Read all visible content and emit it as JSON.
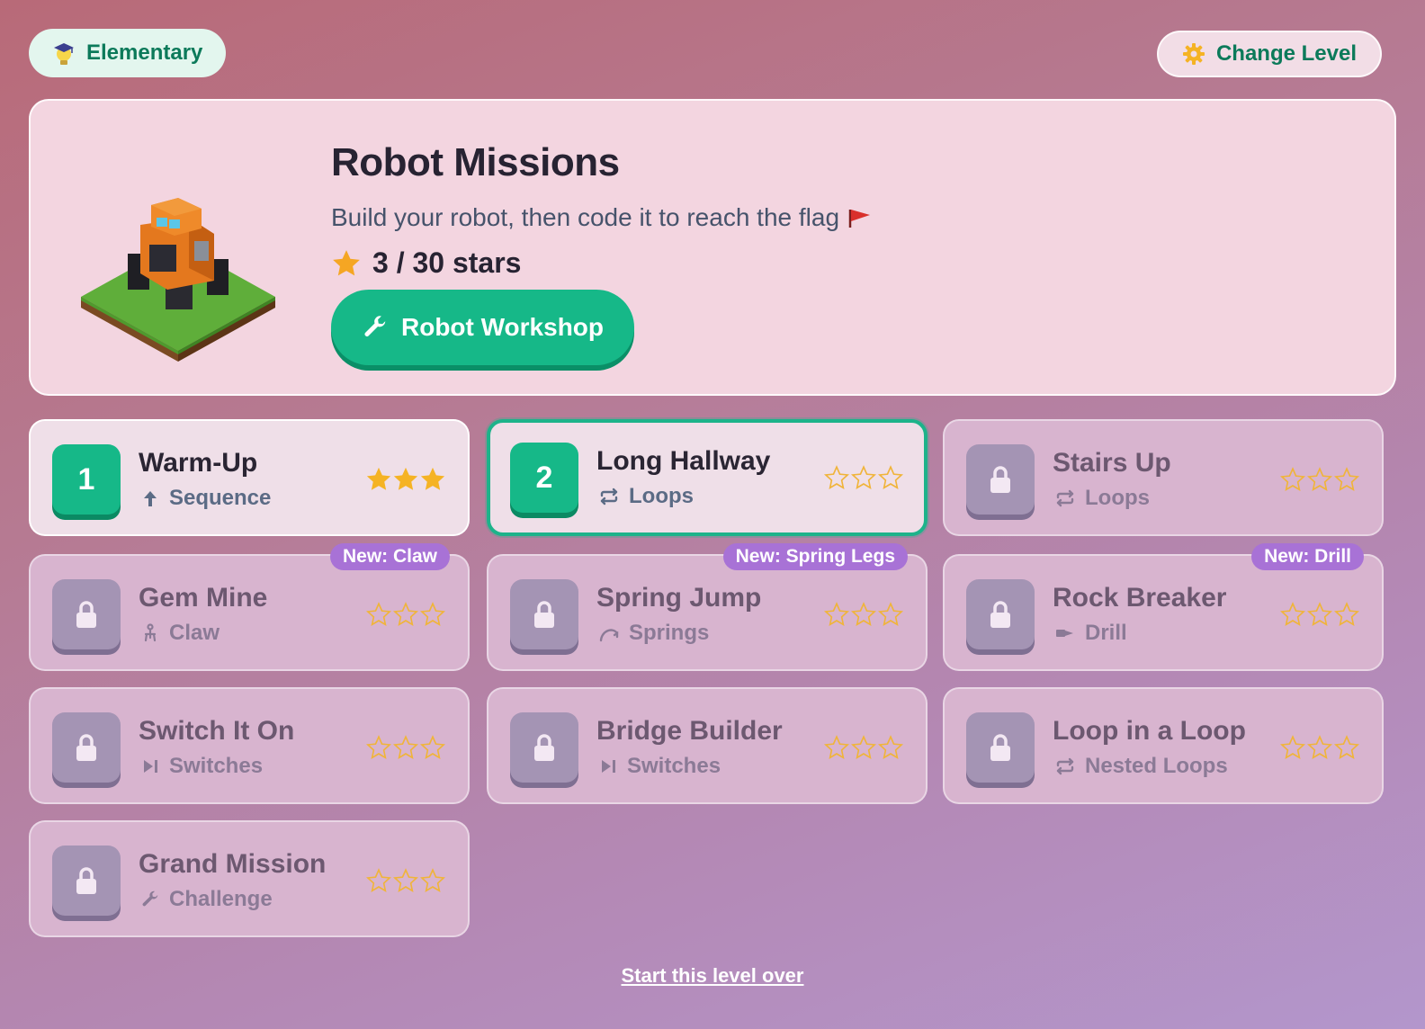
{
  "header": {
    "level_label": "Elementary",
    "level_icon": "graduate-lightbulb-icon",
    "change_label": "Change Level",
    "change_icon": "gear-icon"
  },
  "hero": {
    "title": "Robot Missions",
    "subtitle": "Build your robot, then code it to reach the flag",
    "subtitle_icon": "red-flag-icon",
    "stars_text": "3 / 30 stars",
    "stars_earned": 3,
    "stars_total": 30,
    "button_label": "Robot Workshop",
    "button_icon": "wrench-icon"
  },
  "missions": [
    {
      "number": "1",
      "title": "Warm-Up",
      "concept": "Sequence",
      "concept_icon": "arrow-up-icon",
      "state": "open",
      "stars": 3
    },
    {
      "number": "2",
      "title": "Long Hallway",
      "concept": "Loops",
      "concept_icon": "repeat-icon",
      "state": "current",
      "stars": 0
    },
    {
      "number": "",
      "title": "Stairs Up",
      "concept": "Loops",
      "concept_icon": "repeat-icon",
      "state": "locked",
      "stars": 0
    },
    {
      "number": "",
      "title": "Gem Mine",
      "concept": "Claw",
      "concept_icon": "claw-icon",
      "state": "locked",
      "stars": 0,
      "tag": "New: Claw"
    },
    {
      "number": "",
      "title": "Spring Jump",
      "concept": "Springs",
      "concept_icon": "spring-arc-icon",
      "state": "locked",
      "stars": 0,
      "tag": "New: Spring Legs"
    },
    {
      "number": "",
      "title": "Rock Breaker",
      "concept": "Drill",
      "concept_icon": "drill-icon",
      "state": "locked",
      "stars": 0,
      "tag": "New: Drill"
    },
    {
      "number": "",
      "title": "Switch It On",
      "concept": "Switches",
      "concept_icon": "play-bar-icon",
      "state": "locked",
      "stars": 0
    },
    {
      "number": "",
      "title": "Bridge Builder",
      "concept": "Switches",
      "concept_icon": "play-bar-icon",
      "state": "locked",
      "stars": 0
    },
    {
      "number": "",
      "title": "Loop in a Loop",
      "concept": "Nested Loops",
      "concept_icon": "repeat-icon",
      "state": "locked",
      "stars": 0
    },
    {
      "number": "",
      "title": "Grand Mission",
      "concept": "Challenge",
      "concept_icon": "wrench-icon",
      "state": "locked",
      "stars": 0
    }
  ],
  "footer": {
    "reset_label": "Start this level over"
  },
  "colors": {
    "accent": "#16b888",
    "tag": "#a872d6",
    "star_gold": "#f5b324",
    "locked": "#a494b4"
  }
}
